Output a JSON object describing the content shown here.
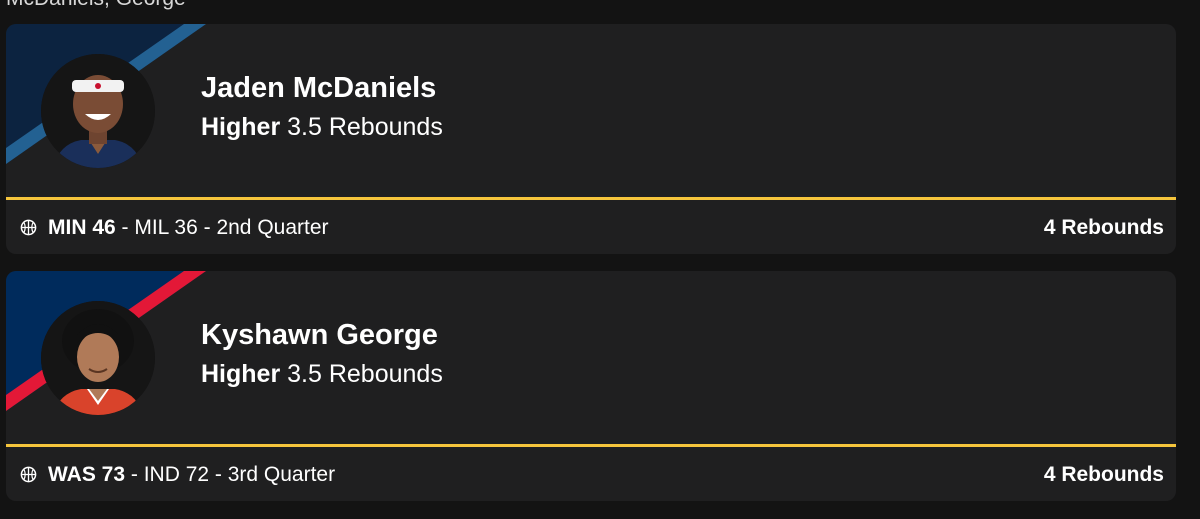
{
  "header": {
    "title": "McDaniels, George"
  },
  "colors": {
    "background": "#131313",
    "card": "#1f1f20",
    "divider": "#f5c53c",
    "min_navy": "#0c2340",
    "min_blue": "#236192",
    "was_navy": "#002b5c",
    "was_red": "#e31837"
  },
  "picks": [
    {
      "player_name": "Jaden McDaniels",
      "direction": "Higher",
      "line": "3.5 Rebounds",
      "score_home": "MIN 46",
      "score_rest": "- MIL 36 - 2nd Quarter",
      "result": "4 Rebounds",
      "icon": "basketball-icon"
    },
    {
      "player_name": "Kyshawn George",
      "direction": "Higher",
      "line": "3.5 Rebounds",
      "score_home": "WAS 73",
      "score_rest": "- IND 72 - 3rd Quarter",
      "result": "4 Rebounds",
      "icon": "basketball-icon"
    }
  ]
}
